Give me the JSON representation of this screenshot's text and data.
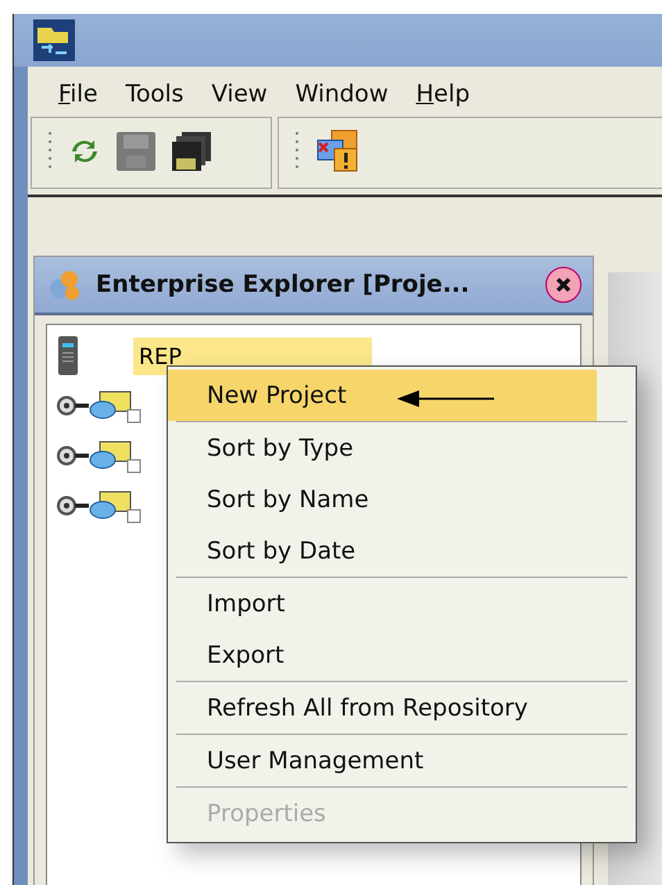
{
  "menu_bar": [
    {
      "label": "File",
      "mnemonic": true
    },
    {
      "label": "Tools",
      "mnemonic": false
    },
    {
      "label": "View",
      "mnemonic": false
    },
    {
      "label": "Window",
      "mnemonic": false
    },
    {
      "label": "Help",
      "mnemonic": true
    }
  ],
  "explorer": {
    "title": "Enterprise Explorer [Proje...",
    "tree": {
      "label": "REP",
      "selected": true
    }
  },
  "context_menu": {
    "groups": [
      [
        {
          "label": "New Project",
          "selected": true,
          "disabled": false
        }
      ],
      [
        {
          "label": "Sort by Type",
          "selected": false,
          "disabled": false
        },
        {
          "label": "Sort by Name",
          "selected": false,
          "disabled": false
        },
        {
          "label": "Sort by Date",
          "selected": false,
          "disabled": false
        }
      ],
      [
        {
          "label": "Import",
          "selected": false,
          "disabled": false
        },
        {
          "label": "Export",
          "selected": false,
          "disabled": false
        }
      ],
      [
        {
          "label": "Refresh All from Repository",
          "selected": false,
          "disabled": false
        }
      ],
      [
        {
          "label": "User Management",
          "selected": false,
          "disabled": false
        }
      ],
      [
        {
          "label": "Properties",
          "selected": false,
          "disabled": true
        }
      ]
    ]
  }
}
